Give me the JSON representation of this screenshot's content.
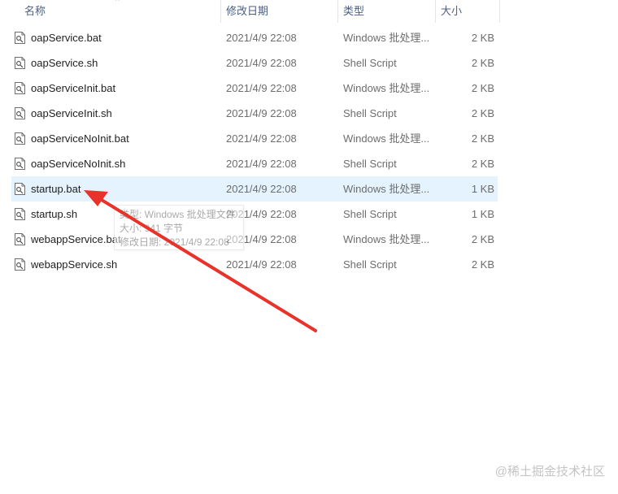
{
  "columns": {
    "name": "名称",
    "date": "修改日期",
    "type": "类型",
    "size": "大小",
    "sort_indicator": "^"
  },
  "files": [
    {
      "name": "oapService.bat",
      "date": "2021/4/9 22:08",
      "type": "Windows 批处理...",
      "size": "2 KB",
      "icon": "script-file-icon",
      "selected": false
    },
    {
      "name": "oapService.sh",
      "date": "2021/4/9 22:08",
      "type": "Shell Script",
      "size": "2 KB",
      "icon": "script-file-icon",
      "selected": false
    },
    {
      "name": "oapServiceInit.bat",
      "date": "2021/4/9 22:08",
      "type": "Windows 批处理...",
      "size": "2 KB",
      "icon": "script-file-icon",
      "selected": false
    },
    {
      "name": "oapServiceInit.sh",
      "date": "2021/4/9 22:08",
      "type": "Shell Script",
      "size": "2 KB",
      "icon": "script-file-icon",
      "selected": false
    },
    {
      "name": "oapServiceNoInit.bat",
      "date": "2021/4/9 22:08",
      "type": "Windows 批处理...",
      "size": "2 KB",
      "icon": "script-file-icon",
      "selected": false
    },
    {
      "name": "oapServiceNoInit.sh",
      "date": "2021/4/9 22:08",
      "type": "Shell Script",
      "size": "2 KB",
      "icon": "script-file-icon",
      "selected": false
    },
    {
      "name": "startup.bat",
      "date": "2021/4/9 22:08",
      "type": "Windows 批处理...",
      "size": "1 KB",
      "icon": "script-file-icon",
      "selected": true
    },
    {
      "name": "startup.sh",
      "date": "2021/4/9 22:08",
      "type": "Shell Script",
      "size": "1 KB",
      "icon": "script-file-icon",
      "selected": false
    },
    {
      "name": "webappService.bat",
      "date": "2021/4/9 22:08",
      "type": "Windows 批处理...",
      "size": "2 KB",
      "icon": "script-file-icon",
      "selected": false
    },
    {
      "name": "webappService.sh",
      "date": "2021/4/9 22:08",
      "type": "Shell Script",
      "size": "2 KB",
      "icon": "script-file-icon",
      "selected": false
    }
  ],
  "tooltip": {
    "line1": "类型: Windows 批处理文件",
    "line2": "大小: 941 字节",
    "line3": "修改日期: 2021/4/9 22:08"
  },
  "annotation": {
    "color": "#e8322a",
    "icon": "red-arrow-annotation"
  },
  "watermark": "@稀土掘金技术社区",
  "colors": {
    "selected_row": "#e5f3ff",
    "header_text": "#4d6082"
  }
}
